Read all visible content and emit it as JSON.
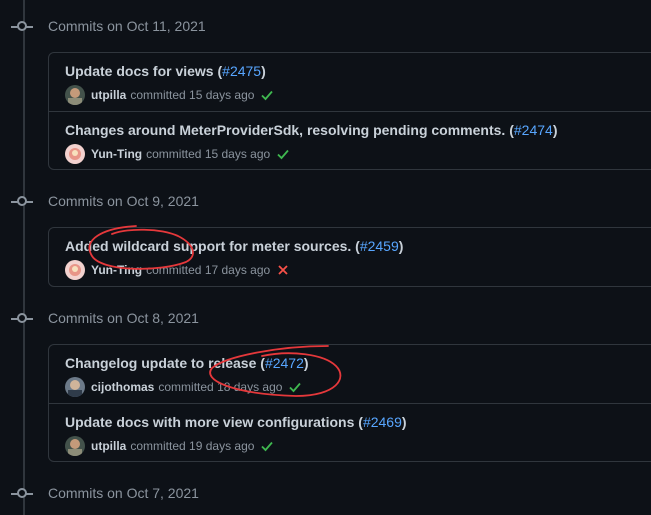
{
  "groups": [
    {
      "date_label": "Commits on Oct 11, 2021",
      "commits": [
        {
          "title": "Update docs for views (",
          "pr": "#2475",
          "tail": ")",
          "author": "utpilla",
          "verb": "committed",
          "age": "15 days ago",
          "status": "success"
        },
        {
          "title": "Changes around MeterProviderSdk, resolving pending comments. (",
          "pr": "#2474",
          "tail": ")",
          "author": "Yun-Ting",
          "verb": "committed",
          "age": "15 days ago",
          "status": "success"
        }
      ]
    },
    {
      "date_label": "Commits on Oct 9, 2021",
      "commits": [
        {
          "title": "Added wildcard support for meter sources. (",
          "pr": "#2459",
          "tail": ")",
          "author": "Yun-Ting",
          "verb": "committed",
          "age": "17 days ago",
          "status": "failure"
        }
      ]
    },
    {
      "date_label": "Commits on Oct 8, 2021",
      "commits": [
        {
          "title": "Changelog update to release (",
          "pr": "#2472",
          "tail": ")",
          "author": "cijothomas",
          "verb": "committed",
          "age": "18 days ago",
          "status": "success"
        },
        {
          "title": "Update docs with more view configurations (",
          "pr": "#2469",
          "tail": ")",
          "author": "utpilla",
          "verb": "committed",
          "age": "19 days ago",
          "status": "success"
        }
      ]
    },
    {
      "date_label": "Commits on Oct 7, 2021",
      "commits": []
    }
  ],
  "colors": {
    "background": "#0d1117",
    "border": "#30363d",
    "link": "#58a6ff",
    "success": "#3fb950",
    "failure": "#f85149",
    "annotation": "#e5383b"
  },
  "icons": {
    "commit": "git-commit-icon",
    "success": "check-icon",
    "failure": "x-icon"
  }
}
